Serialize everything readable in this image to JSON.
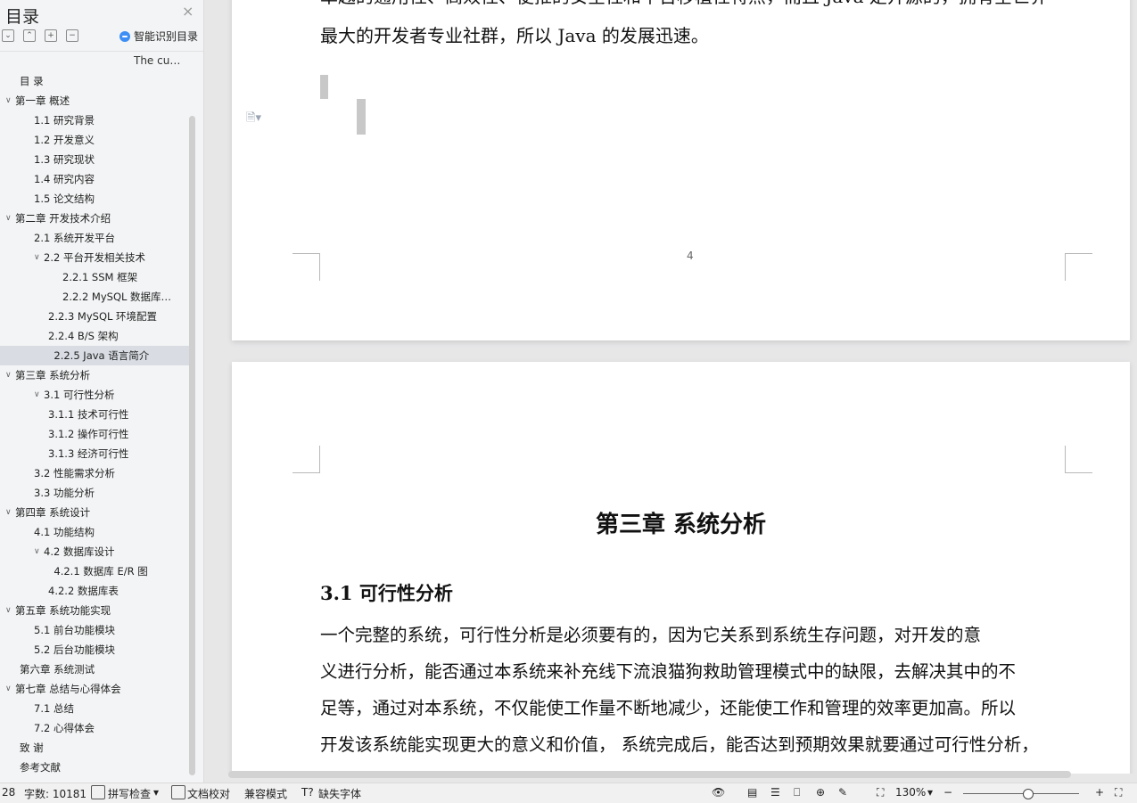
{
  "toc": {
    "title": "目录",
    "close": "×",
    "smart_label": "智能识别目录",
    "note": "The cu…",
    "items": [
      {
        "label": "目  录",
        "indent": 1,
        "chev": ""
      },
      {
        "label": "第一章  概述",
        "indent": 0,
        "chev": "v"
      },
      {
        "label": "1.1  研究背景",
        "indent": 2,
        "chev": ""
      },
      {
        "label": "1.2 开发意义",
        "indent": 2,
        "chev": ""
      },
      {
        "label": "1.3  研究现状",
        "indent": 2,
        "chev": ""
      },
      {
        "label": "1.4  研究内容",
        "indent": 2,
        "chev": ""
      },
      {
        "label": "1.5 论文结构",
        "indent": 2,
        "chev": ""
      },
      {
        "label": " 第二章  开发技术介绍",
        "indent": 0,
        "chev": "v"
      },
      {
        "label": "2.1  系统开发平台",
        "indent": 2,
        "chev": ""
      },
      {
        "label": "2.2  平台开发相关技术",
        "indent": 2,
        "chev": "v"
      },
      {
        "label": "2.2.1 SSM 框架",
        "indent": 4,
        "chev": ""
      },
      {
        "label": "2.2.2   MySQL 数据库…",
        "indent": 4,
        "chev": ""
      },
      {
        "label": "2.2.3   MySQL 环境配置",
        "indent": 3,
        "chev": ""
      },
      {
        "label": "2.2.4   B/S 架构",
        "indent": 3,
        "chev": ""
      },
      {
        "label": "2.2.5 Java 语言简介",
        "indent": 3.4,
        "chev": "",
        "sel": true
      },
      {
        "label": "第三章  系统分析",
        "indent": 0,
        "chev": "v"
      },
      {
        "label": "3.1  可行性分析",
        "indent": 2,
        "chev": "v"
      },
      {
        "label": "3.1.1  技术可行性",
        "indent": 3,
        "chev": ""
      },
      {
        "label": "3.1.2  操作可行性",
        "indent": 3,
        "chev": ""
      },
      {
        "label": "3.1.3 经济可行性",
        "indent": 3,
        "chev": ""
      },
      {
        "label": "3.2 性能需求分析",
        "indent": 2,
        "chev": ""
      },
      {
        "label": "3.3 功能分析",
        "indent": 2,
        "chev": ""
      },
      {
        "label": "第四章  系统设计",
        "indent": 0,
        "chev": "v"
      },
      {
        "label": "4.1 功能结构",
        "indent": 2,
        "chev": ""
      },
      {
        "label": "4.2  数据库设计",
        "indent": 2,
        "chev": "v"
      },
      {
        "label": "4.2.1  数据库 E/R 图",
        "indent": 3.4,
        "chev": ""
      },
      {
        "label": "4.2.2  数据库表",
        "indent": 3,
        "chev": ""
      },
      {
        "label": "第五章  系统功能实现",
        "indent": 0,
        "chev": "v"
      },
      {
        "label": "5.1 前台功能模块",
        "indent": 2,
        "chev": ""
      },
      {
        "label": "5.2 后台功能模块",
        "indent": 2,
        "chev": ""
      },
      {
        "label": "第六章  系统测试",
        "indent": 1,
        "chev": ""
      },
      {
        "label": "第七章  总结与心得体会",
        "indent": 0,
        "chev": "v"
      },
      {
        "label": "7.1 总结",
        "indent": 2,
        "chev": ""
      },
      {
        "label": "7.2 心得体会",
        "indent": 2,
        "chev": ""
      },
      {
        "label": "致  谢",
        "indent": 1,
        "chev": ""
      },
      {
        "label": "参考文献",
        "indent": 1,
        "chev": ""
      }
    ]
  },
  "doc": {
    "page1_top_line": "卓越的通用性、高效性、便推的安全性和平台移植性特点，而且 Java 是开源的，拥有全世界",
    "page1_line2": "最大的开发者专业社群，所以 Java 的发展迅速。",
    "page_number": "4",
    "chapter_title": "第三章  系统分析",
    "section_title": "3.1  可行性分析",
    "paragraph_lines": [
      "    一个完整的系统，可行性分析是必须要有的，因为它关系到系统生存问题，对开发的意",
      "义进行分析，能否通过本系统来补充线下流浪猫狗救助管理模式中的缺限，去解决其中的不",
      "足等，通过对本系统，不仅能使工作量不断地减少，还能使工作和管理的效率更加高。所以",
      "开发该系统能实现更大的意义和价值， 系统完成后，能否达到预期效果就要通过可行性分析，"
    ]
  },
  "status": {
    "page_frag": "28",
    "word_count": "字数: 10181",
    "spell_check": "拼写检查",
    "doc_check": "文档校对",
    "compat": "兼容模式",
    "missing_font": "缺失字体",
    "zoom": "130%",
    "zoom_level_percent": 55
  }
}
